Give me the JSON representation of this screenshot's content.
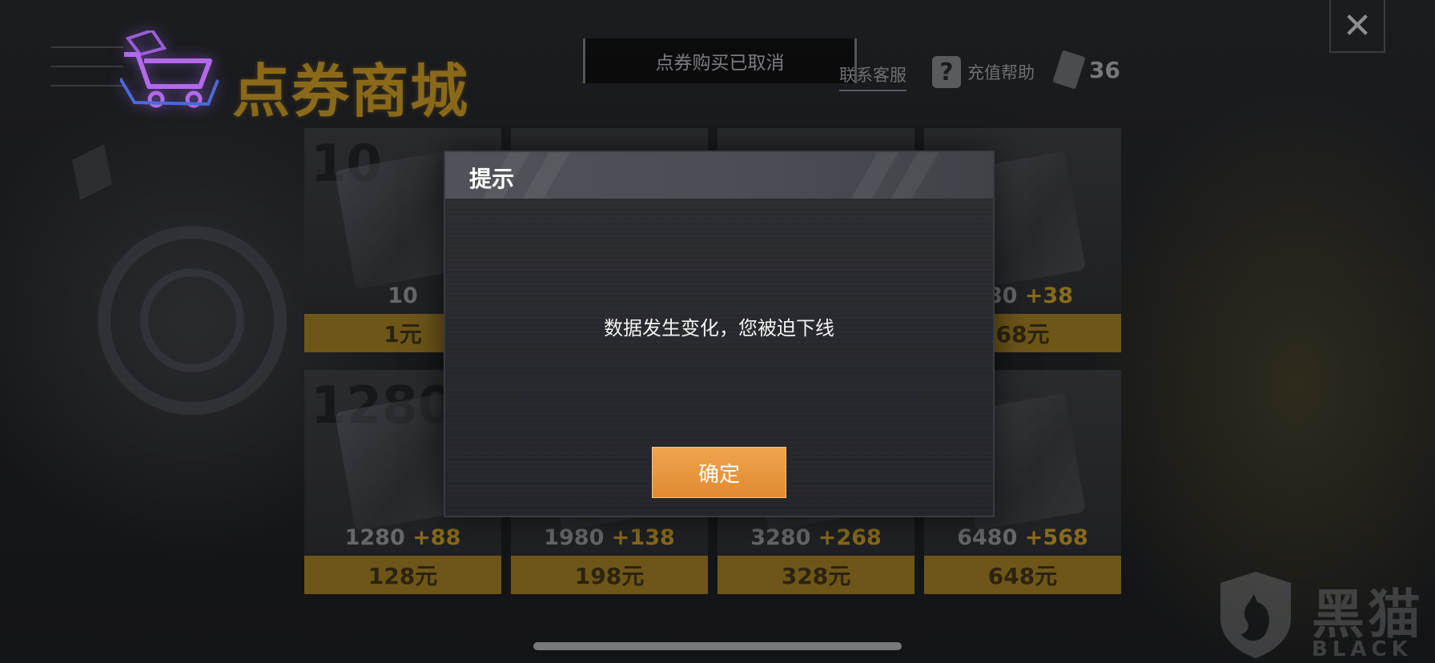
{
  "header": {
    "store_title": "点券商城",
    "toast": "点券购买已取消",
    "contact_service": "联系客服",
    "recharge_help": "充值帮助",
    "help_icon_glyph": "?",
    "balance": "36",
    "close_glyph": "✕"
  },
  "packages": [
    {
      "big_num": "10",
      "amount": "10",
      "bonus": "",
      "price": "1元"
    },
    {
      "big_num": "",
      "amount": "",
      "bonus": "",
      "price": ""
    },
    {
      "big_num": "",
      "amount": "",
      "bonus": "",
      "price": ""
    },
    {
      "big_num": "",
      "amount": "680",
      "bonus": "+38",
      "price": "68元"
    },
    {
      "big_num": "1280",
      "amount": "1280",
      "bonus": "+88",
      "price": "128元"
    },
    {
      "big_num": "",
      "amount": "1980",
      "bonus": "+138",
      "price": "198元"
    },
    {
      "big_num": "",
      "amount": "3280",
      "bonus": "+268",
      "price": "328元"
    },
    {
      "big_num": "",
      "amount": "6480",
      "bonus": "+568",
      "price": "648元"
    }
  ],
  "dialog": {
    "title": "提示",
    "message": "数据发生变化，您被迫下线",
    "confirm": "确定"
  },
  "watermark": {
    "cn": "黑猫",
    "en": "BLACK CAT"
  },
  "colors": {
    "accent_gold": "#8a6a1a",
    "confirm_orange": "#e89a42",
    "dialog_header": "#4f5258"
  }
}
